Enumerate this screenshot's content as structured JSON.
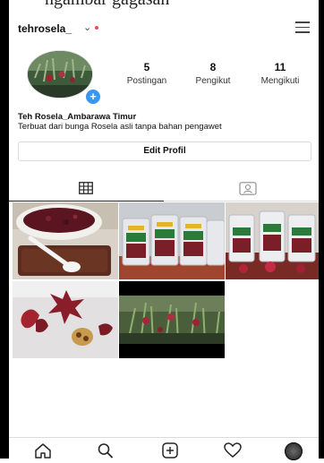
{
  "top_strip_text": "ngambar gagasan",
  "profile": {
    "username": "tehrosela_",
    "dropdown_icon": "chevron-down-icon",
    "menu_icon": "hamburger-menu-icon",
    "stats": [
      {
        "value": "5",
        "label": "Postingan"
      },
      {
        "value": "8",
        "label": "Pengikut"
      },
      {
        "value": "11",
        "label": "Mengikuti"
      }
    ],
    "name": "Teh Rosela_Ambarawa Timur",
    "bio": "Terbuat dari bunga Rosela asli tanpa bahan pengawet",
    "edit_label": "Edit Profil",
    "add_story": "+"
  },
  "tabs": [
    {
      "name": "posts-grid",
      "icon": "grid-icon",
      "active": true
    },
    {
      "name": "tagged",
      "icon": "tagged-person-icon",
      "active": false
    }
  ],
  "posts": [
    {
      "subject": "dried rosella in bowl"
    },
    {
      "subject": "rosella tea packages"
    },
    {
      "subject": "rosella packages with flowers"
    },
    {
      "subject": "fresh rosella calyces and seeds"
    },
    {
      "subject": "rosella plant"
    }
  ],
  "bottom_nav": [
    {
      "name": "home",
      "icon": "home-icon"
    },
    {
      "name": "search",
      "icon": "search-icon"
    },
    {
      "name": "new-post",
      "icon": "add-post-icon"
    },
    {
      "name": "activity",
      "icon": "heart-icon"
    },
    {
      "name": "profile",
      "icon": "profile-avatar-icon"
    }
  ],
  "colors": {
    "accent_blue": "#3897f0",
    "notification_red": "#ed4956",
    "text": "#111111",
    "border": "#dbdbdb"
  }
}
